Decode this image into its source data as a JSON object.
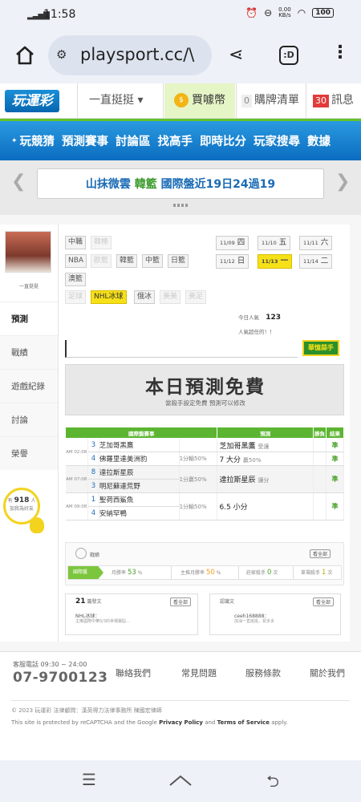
{
  "status_bar": {
    "time": "11:58",
    "net_speed_top": "0.00",
    "net_speed_unit": "KB/s",
    "battery": "100"
  },
  "browser": {
    "url": "playsport.cc/\\",
    "tabs_label": ":D"
  },
  "header": {
    "logo": "玩運彩",
    "selector": "一直挺挺",
    "coins_label": "買噱幣",
    "cart_count": "0",
    "cart_label": "購牌清單",
    "msg_count": "30",
    "msg_label": "訊息"
  },
  "nav": {
    "items": [
      "玩競猜",
      "預測賽事",
      "討論區",
      "找高手",
      "即時比分",
      "玩家搜尋",
      "數據"
    ]
  },
  "marquee": {
    "part1": "山抹微雲",
    "part2": "韓籃",
    "part3": "國際盤近19日24過19"
  },
  "user": {
    "name": "一直挺挺"
  },
  "leftnav": {
    "tabs": [
      "預測",
      "戰績",
      "遊戲紀錄",
      "討論",
      "榮譽"
    ]
  },
  "fans": {
    "prefix": "有",
    "count": "918",
    "suffix": "人",
    "line2": "加我為好友"
  },
  "leagues": {
    "row1": [
      "中職",
      "韓棒"
    ],
    "row2": [
      "NBA",
      "歐籃",
      "韓籃",
      "中籃",
      "日籃"
    ],
    "row3": [
      "澳籃"
    ],
    "row4": [
      "足球",
      "NHL冰球",
      "俄冰",
      "美美",
      "美足"
    ]
  },
  "dates": [
    {
      "md": "11/09",
      "wd": "四"
    },
    {
      "md": "11/10",
      "wd": "五"
    },
    {
      "md": "11/11",
      "wd": "六"
    },
    {
      "md": "11/12",
      "wd": "日"
    },
    {
      "md": "11/13",
      "wd": "一"
    },
    {
      "md": "11/14",
      "wd": "二"
    }
  ],
  "stats": {
    "today_label": "今日人氣",
    "today_value": "123",
    "total_label": "人氣超任的！！"
  },
  "helper_badge": "華憶蒜手",
  "free": {
    "title": "本日預測免費",
    "subtitle": "當殺手設定免費 預測可以修改"
  },
  "table": {
    "headers": [
      "國際盤賽事",
      "預測",
      "勝負",
      "結果"
    ],
    "games": [
      {
        "ampm": "AM 02:08",
        "n1": "3",
        "t1": "芝加哥黑鷹",
        "n2": "4",
        "t2": "佛羅里達美洲豹",
        "odds": "1分輸50%",
        "p1": "芝加哥黑鷹",
        "p1s": "受讓",
        "p2": "7 大分",
        "p2s": "贏50%",
        "r1": "準",
        "r2": "準"
      },
      {
        "ampm": "AM 07:08",
        "n1": "8",
        "t1": "達拉斯星辰",
        "n2": "3",
        "t2": "明尼蘇達荒野",
        "odds": "1分贏50%",
        "p1": "達拉斯星辰",
        "p1s": "讓分",
        "p2": "",
        "p2s": "",
        "r1": "準",
        "r2": ""
      },
      {
        "ampm": "AM 09:08",
        "n1": "1",
        "t1": "聖荷西鯊魚",
        "n2": "4",
        "t2": "安納罕鴨",
        "odds": "1分輸50%",
        "p1": "6.5 小分",
        "p1s": "",
        "p2": "",
        "p2s": "",
        "r1": "準",
        "r2": ""
      }
    ]
  },
  "rate": {
    "section_label": "戰績",
    "more": "看全部",
    "arrow_label": "國際盤",
    "cells": [
      {
        "label": "月勝率",
        "value": "53",
        "unit": "%"
      },
      {
        "label": "主推月勝率",
        "value": "50",
        "unit": "%"
      },
      {
        "label": "莊家殺手",
        "value": "0",
        "unit": "次"
      },
      {
        "label": "單場殺手",
        "value": "1",
        "unit": "次"
      }
    ]
  },
  "box_left": {
    "count": "21",
    "label": "篇發文",
    "more": "看全部",
    "line1": "NHL冰球：",
    "line2": "主推國際中華0/3的世場寶貼..."
  },
  "box_right": {
    "label": "認識文",
    "more": "看全部",
    "line1": "ceeh168888：",
    "line2": "加油一直挺挺，祝多多"
  },
  "footer": {
    "service_hours": "客服電話 09:30 ~ 24:00",
    "phone": "07-9700123",
    "links": [
      "聯絡我們",
      "常見問題",
      "服務條款",
      "關於我們"
    ],
    "copyright": "© 2023 玩運彩 法律顧問：漢英得力法律事務所 陳國宏律師",
    "recaptcha_prefix": "This site is protected by reCAPTCHA and the Google",
    "privacy": "Privacy Policy",
    "and": "and",
    "terms": "Terms of Service",
    "apply": "apply."
  }
}
